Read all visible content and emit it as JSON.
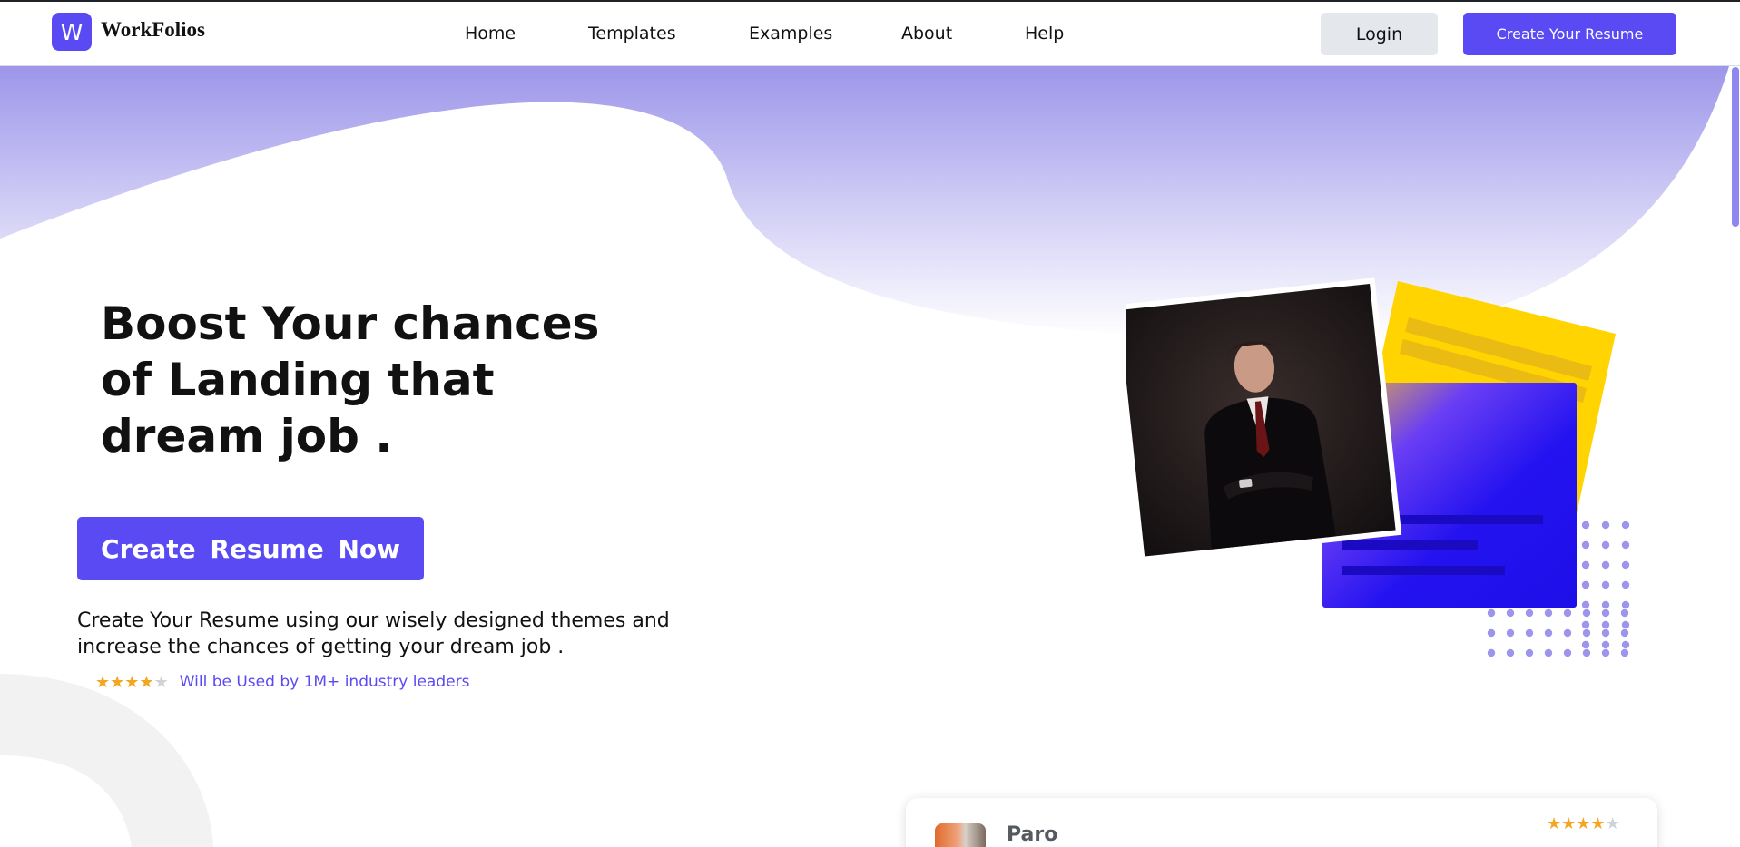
{
  "header": {
    "logo_letter": "W",
    "brand": "WorkFolios",
    "nav": [
      "Home",
      "Templates",
      "Examples",
      "About",
      "Help"
    ],
    "login_label": "Login",
    "create_label": "Create Your Resume"
  },
  "hero": {
    "headline_lines": [
      "Boost Your chances",
      "of Landing that",
      "dream job ."
    ],
    "cta_label": "Create  Resume  Now",
    "subtext_lines": [
      "Create Your Resume using our wisely designed themes and",
      "increase the chances of getting your dream job ."
    ],
    "rating": {
      "value": 4,
      "max": 5,
      "text": "Will be Used by 1M+ industry leaders"
    }
  },
  "testimonial": {
    "name": "Paro",
    "rating": 4,
    "max": 5
  },
  "colors": {
    "accent": "#5a4af4",
    "star": "#f4a623",
    "yellow_card": "#ffd400",
    "blue_card": "#2413f0",
    "dots": "#9d94ec"
  }
}
